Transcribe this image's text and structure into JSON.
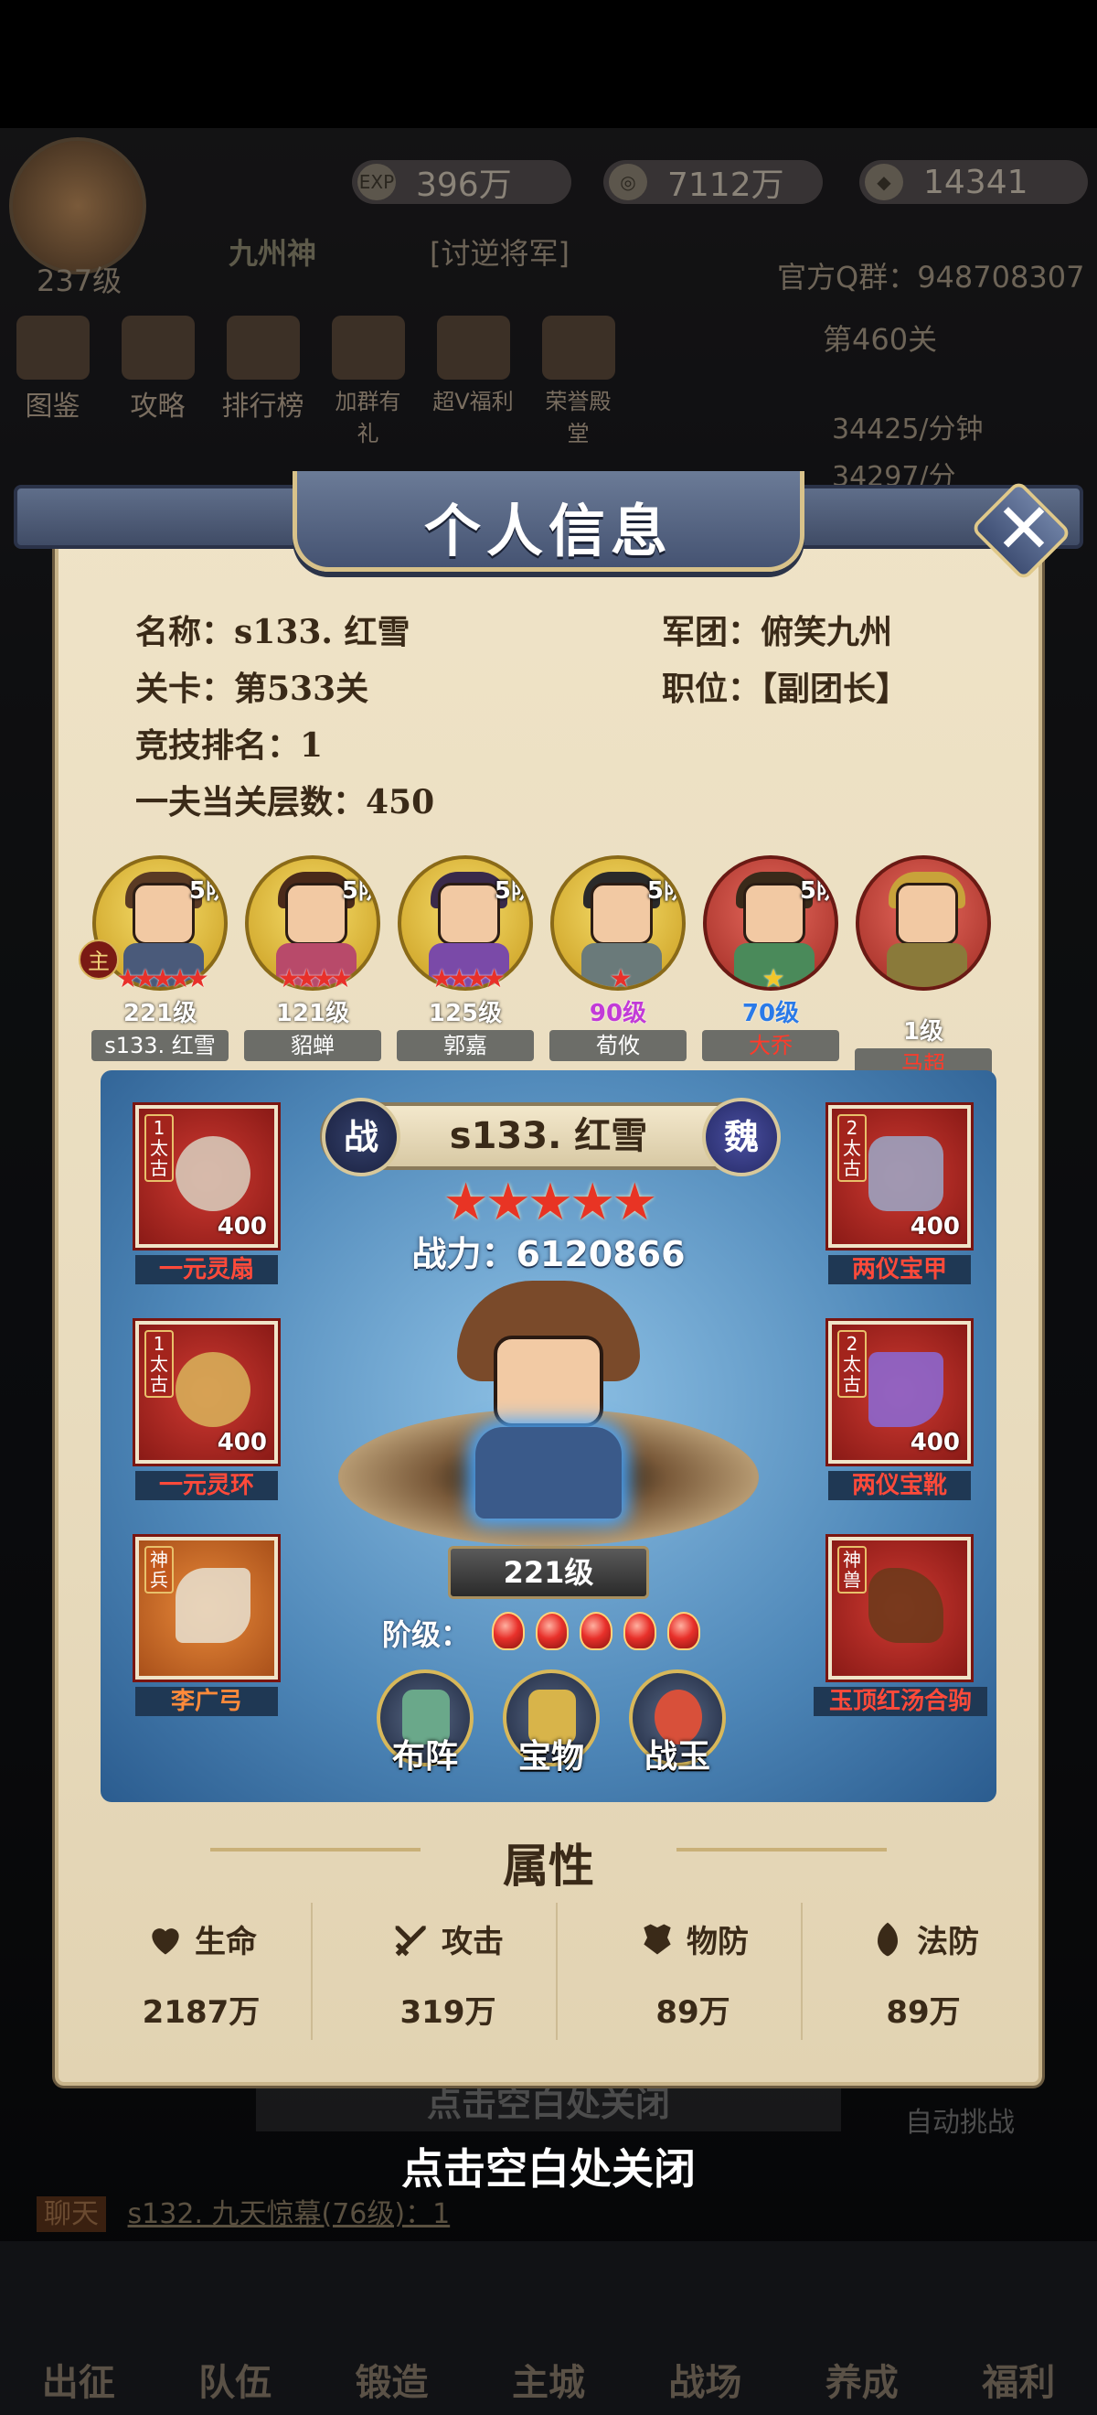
{
  "hud": {
    "exp": "396万",
    "exp_icon": "EXP",
    "coins": "7112万",
    "gold": "14341",
    "player_level": "237级",
    "player_name": "九州神",
    "title_tag": "[讨逆将军]",
    "qq_group": "官方Q群：948708307",
    "stage": "第460关",
    "rate1": "34425/分钟",
    "rate2": "34297/分",
    "menu": [
      "图鉴",
      "攻略",
      "排行榜",
      "加群有礼",
      "超V福利",
      "荣誉殿堂"
    ]
  },
  "panel": {
    "title": "个人信息",
    "close_symbol": "✕",
    "info": {
      "name": "名称：s133. 红雪",
      "legion": "军团：俯笑九州",
      "stage": "关卡：第533关",
      "position": "职位：【副团长】",
      "arena": "竞技排名：1",
      "tower": "一夫当关层数：450"
    },
    "heroes": [
      {
        "name": "s133. 红雪",
        "level": "221级",
        "grade": "5阶",
        "stars": "★★★★★",
        "frame": "gold",
        "main_badge": "主",
        "level_color": "#ffffff"
      },
      {
        "name": "貂蝉",
        "level": "121级",
        "grade": "5阶",
        "stars": "★★★★",
        "frame": "gold",
        "level_color": "#ffffff"
      },
      {
        "name": "郭嘉",
        "level": "125级",
        "grade": "5阶",
        "stars": "★★★★",
        "frame": "gold",
        "level_color": "#ffffff"
      },
      {
        "name": "荀攸",
        "level": "90级",
        "grade": "5阶",
        "stars": "★",
        "frame": "gold",
        "level_color": "#c23ad8"
      },
      {
        "name": "大乔",
        "level": "70级",
        "grade": "5阶",
        "stars": "★",
        "frame": "red",
        "level_color": "#2a7ae8",
        "name_color": "#ff3a2a"
      },
      {
        "name": "马超",
        "level": "1级",
        "grade": "",
        "stars": "",
        "frame": "red",
        "level_color": "#ffffff",
        "name_color": "#ff3a2a"
      }
    ],
    "display": {
      "hero_name": "s133. 红雪",
      "seal_left": "战",
      "seal_right": "魏",
      "stars": "★★★★★",
      "power": "战力：6120866",
      "level": "221级",
      "rank_label": "阶级：",
      "gems": 5,
      "actions": [
        "布阵",
        "宝物",
        "战玉"
      ]
    },
    "equipment_left": [
      {
        "label": "一元灵扇",
        "tag": "1太古",
        "count": "400",
        "icon": "fan-icon"
      },
      {
        "label": "一元灵环",
        "tag": "1太古",
        "count": "400",
        "icon": "ring-icon"
      },
      {
        "label": "李广弓",
        "tag": "神兵",
        "count": "",
        "icon": "bow-icon"
      }
    ],
    "equipment_right": [
      {
        "label": "两仪宝甲",
        "tag": "2太古",
        "count": "400",
        "icon": "armor-icon"
      },
      {
        "label": "两仪宝靴",
        "tag": "2太古",
        "count": "400",
        "icon": "boots-icon"
      },
      {
        "label": "玉顶红汤合驹",
        "tag": "神兽",
        "count": "",
        "icon": "horse-icon"
      }
    ],
    "attributes_title": "属性",
    "attributes": [
      {
        "name": "生命",
        "value": "2187万",
        "icon": "heart-icon"
      },
      {
        "name": "攻击",
        "value": "319万",
        "icon": "swords-icon"
      },
      {
        "name": "物防",
        "value": "89万",
        "icon": "armor-shield-icon"
      },
      {
        "name": "法防",
        "value": "89万",
        "icon": "mage-shield-icon"
      }
    ]
  },
  "footer": {
    "tap_close": "点击空白处关闭",
    "ghost_close": "点击空白处关闭",
    "auto_battle": "自动挑战",
    "chat_tag": "聊天",
    "chat_text": "s132. 九天惊幕(76级)：1",
    "nav": [
      "出征",
      "队伍",
      "锻造",
      "主城",
      "战场",
      "养成",
      "福利"
    ]
  },
  "colors": {
    "panel_bg": "#efe3c7",
    "header_blue": "#455372",
    "display_blue": "#4e87b8",
    "equip_red": "#cf3a32",
    "equip_orange": "#e98a3a",
    "star_red": "#e83424"
  }
}
